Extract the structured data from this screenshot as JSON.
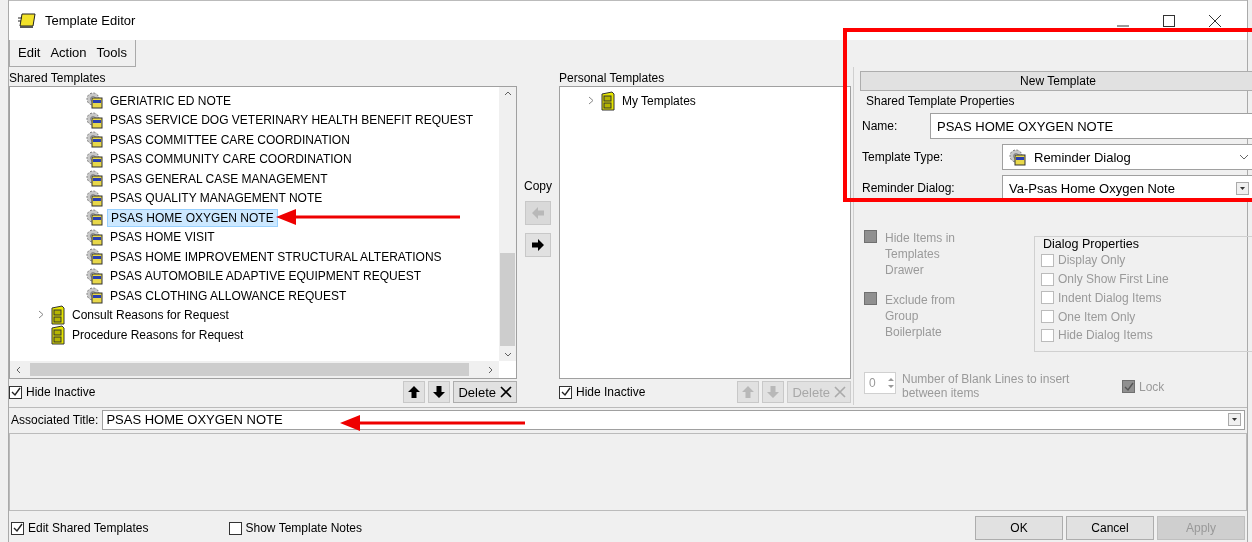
{
  "window": {
    "title": "Template Editor"
  },
  "menu": [
    "Edit",
    "Action",
    "Tools"
  ],
  "shared_templates": {
    "label": "Shared Templates",
    "tree": [
      {
        "children": [
          {
            "label": "GERIATRIC ED NOTE",
            "selected": false
          },
          {
            "label": "PSAS SERVICE DOG VETERINARY HEALTH BENEFIT REQUEST",
            "selected": false
          },
          {
            "label": "PSAS COMMITTEE CARE COORDINATION",
            "selected": false
          },
          {
            "label": "PSAS COMMUNITY CARE COORDINATION",
            "selected": false
          },
          {
            "label": "PSAS GENERAL CASE MANAGEMENT",
            "selected": false
          },
          {
            "label": "PSAS QUALITY MANAGEMENT NOTE",
            "selected": false
          },
          {
            "label": "PSAS HOME OXYGEN NOTE",
            "selected": true
          },
          {
            "label": "PSAS HOME VISIT",
            "selected": false
          },
          {
            "label": "PSAS HOME IMPROVEMENT STRUCTURAL ALTERATIONS",
            "selected": false
          },
          {
            "label": "PSAS AUTOMOBILE ADAPTIVE EQUIPMENT REQUEST",
            "selected": false
          },
          {
            "label": "PSAS CLOTHING ALLOWANCE REQUEST",
            "selected": false
          }
        ]
      },
      {
        "label": "Consult Reasons for Request",
        "kind": "folder",
        "expandable": true,
        "selected": false
      },
      {
        "label": "Procedure Reasons for Request",
        "kind": "folder",
        "expandable": false,
        "selected": false
      }
    ],
    "hide_inactive": {
      "label": "Hide Inactive",
      "checked": true
    },
    "delete": {
      "label": "Delete",
      "disabled": false
    }
  },
  "copy": {
    "label": "Copy",
    "left_disabled": true,
    "right_disabled": false
  },
  "personal_templates": {
    "label": "Personal Templates",
    "tree": [
      {
        "label": "My Templates",
        "kind": "folder",
        "expandable": true,
        "selected": false
      }
    ],
    "hide_inactive": {
      "label": "Hide Inactive",
      "checked": true
    },
    "delete": {
      "label": "Delete",
      "disabled": true
    }
  },
  "properties": {
    "new_template": "New Template",
    "group_title": "Shared Template Properties",
    "name": {
      "label": "Name:",
      "value": "PSAS HOME OXYGEN NOTE"
    },
    "template_type": {
      "label": "Template Type:",
      "value": "Reminder Dialog"
    },
    "reminder_dialog": {
      "label": "Reminder Dialog:",
      "value": "Va-Psas Home Oxygen Note"
    },
    "options": [
      {
        "label": "Hide Items in Templates Drawer",
        "checked": false,
        "disabled": true
      },
      {
        "label": "Exclude from Group Boilerplate",
        "checked": false,
        "disabled": true
      }
    ],
    "dialog_properties": {
      "title": "Dialog Properties",
      "items": [
        {
          "label": "Display Only",
          "checked": false,
          "disabled": true
        },
        {
          "label": "Only Show First Line",
          "checked": false,
          "disabled": true
        },
        {
          "label": "Indent Dialog Items",
          "checked": false,
          "disabled": true
        },
        {
          "label": "One Item Only",
          "checked": false,
          "disabled": true
        },
        {
          "label": "Hide Dialog Items",
          "checked": false,
          "disabled": true
        }
      ]
    },
    "blank_lines": {
      "value": "0",
      "label": "Number of Blank Lines to insert between items"
    },
    "lock": {
      "label": "Lock",
      "checked": true,
      "disabled": true
    }
  },
  "associated_title": {
    "label": "Associated Title:",
    "value": "PSAS HOME OXYGEN NOTE"
  },
  "footer": {
    "checks": [
      {
        "label": "Edit Shared Templates",
        "checked": true
      },
      {
        "label": "Show Template Notes",
        "checked": false
      }
    ],
    "buttons": [
      {
        "label": "OK",
        "disabled": false
      },
      {
        "label": "Cancel",
        "disabled": false
      },
      {
        "label": "Apply",
        "disabled": true
      }
    ]
  }
}
